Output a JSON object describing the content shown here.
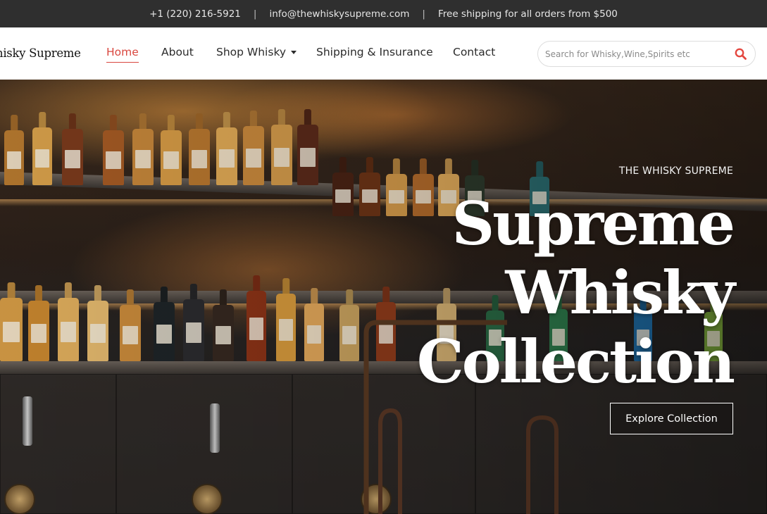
{
  "topbar": {
    "phone": "+1 (220) 216-5921",
    "email": "info@thewhiskysupreme.com",
    "shipping_notice": "Free shipping for all orders from $500",
    "separator": "|"
  },
  "header": {
    "logo_text": "hisky Supreme",
    "nav": [
      {
        "label": "Home",
        "active": true
      },
      {
        "label": "About"
      },
      {
        "label": "Shop Whisky",
        "has_dropdown": true
      },
      {
        "label": "Shipping & Insurance"
      },
      {
        "label": "Contact"
      }
    ],
    "search": {
      "placeholder": "Search for Whisky,Wine,Spirits etc",
      "value": "",
      "icon": "search-icon"
    }
  },
  "hero": {
    "eyebrow": "THE WHISKY SUPREME",
    "headline_lines": [
      "Supreme",
      "Whisky",
      "Collection"
    ],
    "cta_label": "Explore Collection"
  },
  "colors": {
    "accent": "#d9473f",
    "topbar_bg": "#2f2f2f",
    "header_bg": "#ffffff",
    "text_dark": "#2b2b2b"
  }
}
